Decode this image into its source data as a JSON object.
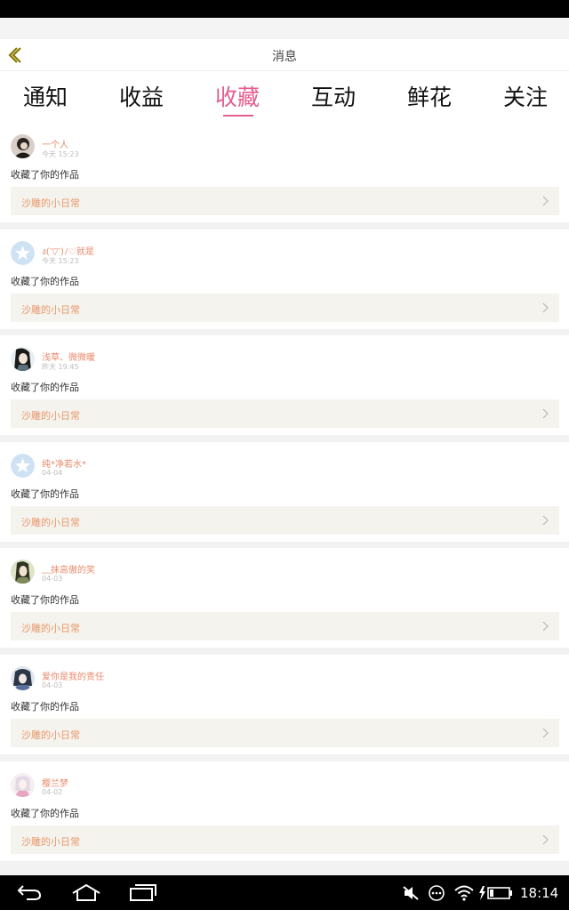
{
  "header": {
    "title": "消息",
    "back_icon": "chevron-left-icon",
    "back_color": "#8a7a00"
  },
  "tabs": [
    {
      "label": "通知",
      "active": false
    },
    {
      "label": "收益",
      "active": false
    },
    {
      "label": "收藏",
      "active": true
    },
    {
      "label": "互动",
      "active": false
    },
    {
      "label": "鲜花",
      "active": false
    },
    {
      "label": "关注",
      "active": false
    }
  ],
  "accent_color": "#e35d8f",
  "notifications": [
    {
      "user": "一个人",
      "time": "今天 15:23",
      "action": "收藏了你的作品",
      "work": "沙雕的小日常",
      "avatar": "photo-dark"
    },
    {
      "user": "ง(′▽‵)ﾉ♡就是",
      "time": "今天 15:23",
      "action": "收藏了你的作品",
      "work": "沙雕的小日常",
      "avatar": "default-star"
    },
    {
      "user": "浅草、微微暖",
      "time": "昨天 19:45",
      "action": "收藏了你的作品",
      "work": "沙雕的小日常",
      "avatar": "photo-anime"
    },
    {
      "user": "纯*净若水*",
      "time": "04-04",
      "action": "收藏了你的作品",
      "work": "沙雕的小日常",
      "avatar": "default-star"
    },
    {
      "user": "﹏抹高傲的笑",
      "time": "04-03",
      "action": "收藏了你的作品",
      "work": "沙雕的小日常",
      "avatar": "photo-green"
    },
    {
      "user": "爱你是我的责任",
      "time": "04-03",
      "action": "收藏了你的作品",
      "work": "沙雕的小日常",
      "avatar": "photo-blue"
    },
    {
      "user": "樱兰梦",
      "time": "04-02",
      "action": "收藏了你的作品",
      "work": "沙雕的小日常",
      "avatar": "photo-pink"
    }
  ],
  "statusbar": {
    "time": "18:14",
    "icons": [
      "mute-icon",
      "more-icon",
      "wifi-icon",
      "battery-charging-icon"
    ]
  },
  "navbar": {
    "icons": [
      "back-nav-icon",
      "home-nav-icon",
      "recents-nav-icon"
    ]
  }
}
